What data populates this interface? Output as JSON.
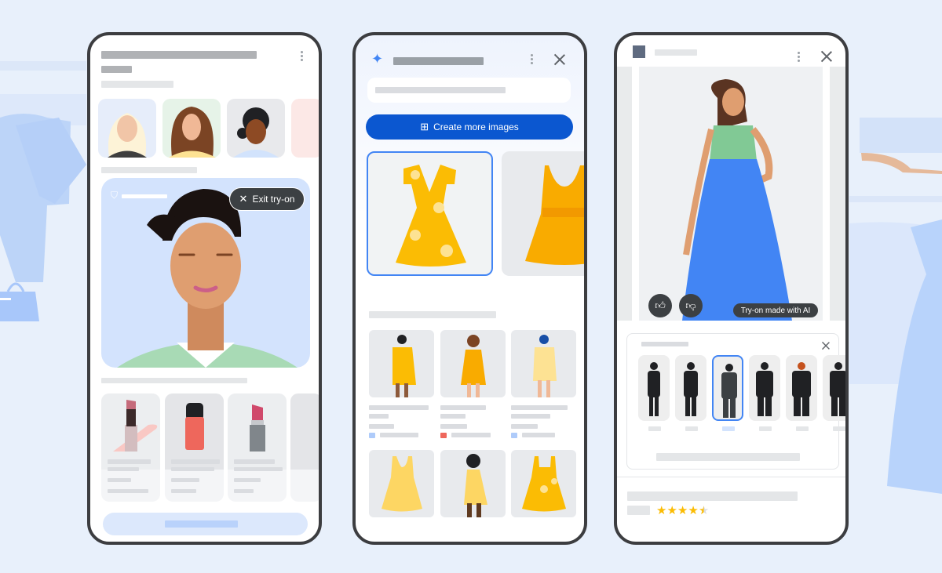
{
  "panel1": {
    "exit_button_label": "Exit try-on",
    "icons": {
      "menu": "more-vert-icon",
      "shield": "shield-icon",
      "close": "close-icon"
    }
  },
  "panel2": {
    "create_button_label": "Create more images",
    "icons": {
      "spark": "gemini-spark-icon",
      "menu": "more-vert-icon",
      "close": "close-icon",
      "image_add": "add-image-icon"
    },
    "swatch_colors": [
      "#aecbfa",
      "#ee675c",
      "#aecbfa"
    ]
  },
  "panel3": {
    "ai_badge_label": "Try-on made with AI",
    "icons": {
      "thumbs_up": "thumbs-up-icon",
      "thumbs_down": "thumbs-down-icon",
      "close": "close-icon",
      "menu": "more-vert-icon"
    },
    "rating": {
      "value": 4.5,
      "max": 5,
      "stars": [
        "★",
        "★",
        "★",
        "★",
        "★"
      ]
    },
    "body_types_count": 6,
    "selected_body_type_index": 2
  },
  "colors": {
    "primary_blue": "#0b57d0",
    "accent_blue": "#4285f4",
    "star": "#fbbc04",
    "dark_chip": "#3c4043"
  }
}
